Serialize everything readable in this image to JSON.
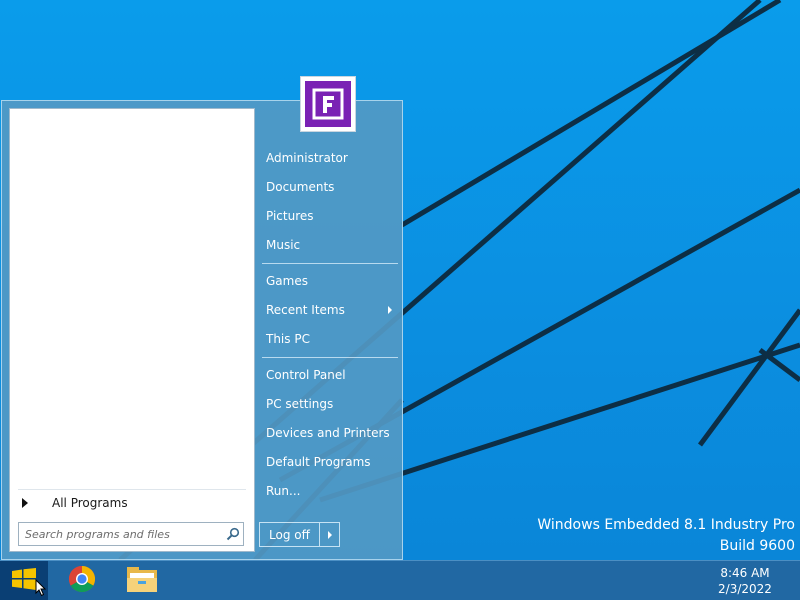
{
  "watermark": {
    "edition": "Windows Embedded 8.1 Industry Pro",
    "build": "Build 9600"
  },
  "start_menu": {
    "all_programs_label": "All Programs",
    "search_placeholder": "Search programs and files",
    "user_tile_icon": "purple-tile-icon",
    "right_items": [
      "Administrator",
      "Documents",
      "Pictures",
      "Music",
      "Games",
      "Recent Items",
      "This PC",
      "Control Panel",
      "PC settings",
      "Devices and Printers",
      "Default Programs",
      "Run..."
    ],
    "log_off_label": "Log off"
  },
  "taskbar": {
    "pinned": [
      "windows-logo-icon",
      "chrome-icon",
      "file-explorer-icon"
    ],
    "clock_time": "8:46 AM",
    "clock_date": "2/3/2022"
  },
  "colors": {
    "desktop": "#0a9ceb",
    "start_menu": "#5299c4",
    "taskbar": "#2266a0",
    "user_tile": "#7a22b4"
  }
}
